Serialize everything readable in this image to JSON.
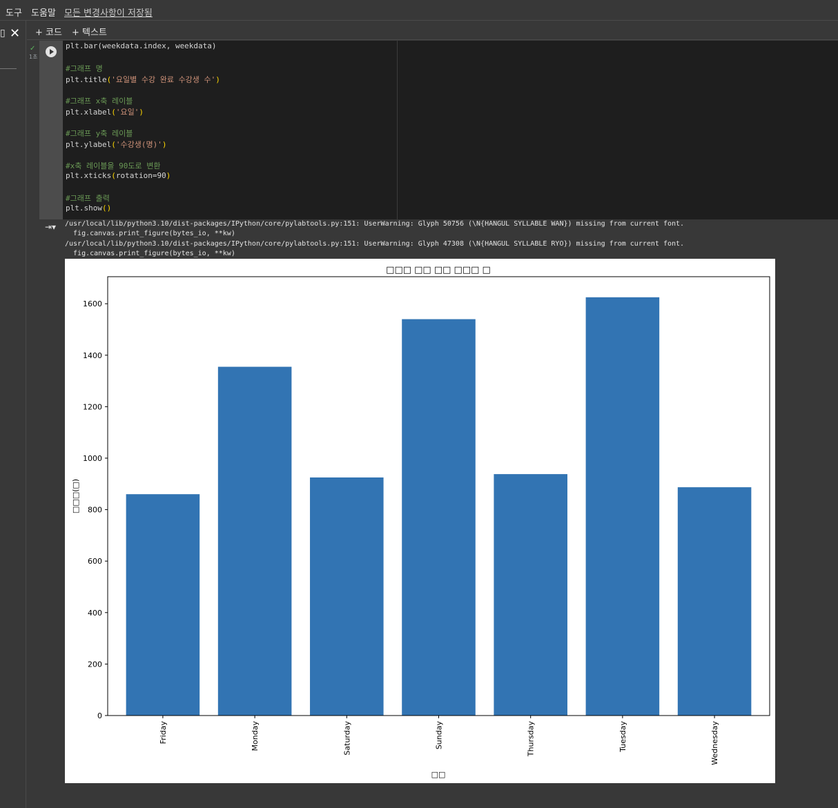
{
  "menubar": {
    "tools": "도구",
    "help": "도움말",
    "saved_status": "모든 변경사항이 저장됨"
  },
  "toolbar": {
    "add_code": "+ 코드",
    "add_text": "+ 텍스트"
  },
  "cell": {
    "exec_time": "1초",
    "code_lines": [
      {
        "kind": "code",
        "parts": [
          {
            "t": "plt.bar(weekdata.index, weekdata)",
            "c": ""
          }
        ]
      },
      {
        "kind": "blank",
        "parts": []
      },
      {
        "kind": "comment",
        "parts": [
          {
            "t": "#그래프 명",
            "c": "cm"
          }
        ]
      },
      {
        "kind": "code",
        "parts": [
          {
            "t": "plt.title",
            "c": ""
          },
          {
            "t": "(",
            "c": "pn"
          },
          {
            "t": "'요일별 수강 완료 수강생 수'",
            "c": "st"
          },
          {
            "t": ")",
            "c": "pn"
          }
        ]
      },
      {
        "kind": "blank",
        "parts": []
      },
      {
        "kind": "comment",
        "parts": [
          {
            "t": "#그래프 x축 레이블",
            "c": "cm"
          }
        ]
      },
      {
        "kind": "code",
        "parts": [
          {
            "t": "plt.xlabel",
            "c": ""
          },
          {
            "t": "(",
            "c": "pn"
          },
          {
            "t": "'요일'",
            "c": "st"
          },
          {
            "t": ")",
            "c": "pn"
          }
        ]
      },
      {
        "kind": "blank",
        "parts": []
      },
      {
        "kind": "comment",
        "parts": [
          {
            "t": "#그래프 y축 레이블",
            "c": "cm"
          }
        ]
      },
      {
        "kind": "code",
        "parts": [
          {
            "t": "plt.ylabel",
            "c": ""
          },
          {
            "t": "(",
            "c": "pn"
          },
          {
            "t": "'수강생(명)'",
            "c": "st"
          },
          {
            "t": ")",
            "c": "pn"
          }
        ]
      },
      {
        "kind": "blank",
        "parts": []
      },
      {
        "kind": "comment",
        "parts": [
          {
            "t": "#x축 레이블을 90도로 변환",
            "c": "cm"
          }
        ]
      },
      {
        "kind": "code",
        "parts": [
          {
            "t": "plt.xticks",
            "c": ""
          },
          {
            "t": "(",
            "c": "pn"
          },
          {
            "t": "rotation=90",
            "c": ""
          },
          {
            "t": ")",
            "c": "pn"
          }
        ]
      },
      {
        "kind": "blank",
        "parts": []
      },
      {
        "kind": "comment",
        "parts": [
          {
            "t": "#그래프 출력",
            "c": "cm"
          }
        ]
      },
      {
        "kind": "code",
        "parts": [
          {
            "t": "plt.show",
            "c": ""
          },
          {
            "t": "()",
            "c": "pn"
          }
        ]
      }
    ]
  },
  "output": {
    "warnings": [
      "/usr/local/lib/python3.10/dist-packages/IPython/core/pylabtools.py:151: UserWarning: Glyph 50756 (\\N{HANGUL SYLLABLE WAN}) missing from current font.",
      "  fig.canvas.print_figure(bytes_io, **kw)",
      "/usr/local/lib/python3.10/dist-packages/IPython/core/pylabtools.py:151: UserWarning: Glyph 47308 (\\N{HANGUL SYLLABLE RYO}) missing from current font.",
      "  fig.canvas.print_figure(bytes_io, **kw)"
    ]
  },
  "chart_data": {
    "type": "bar",
    "title": "□□□ □□ □□ □□□ □",
    "xlabel": "□□",
    "ylabel": "□□□(□)",
    "categories": [
      "Friday",
      "Monday",
      "Saturday",
      "Sunday",
      "Thursday",
      "Tuesday",
      "Wednesday"
    ],
    "values": [
      860,
      1355,
      925,
      1540,
      938,
      1625,
      887
    ],
    "ylim": [
      0,
      1705
    ],
    "yticks": [
      0,
      200,
      400,
      600,
      800,
      1000,
      1200,
      1400,
      1600
    ],
    "bar_color": "#3274b3",
    "xtick_rotation": 90,
    "grid": false
  }
}
